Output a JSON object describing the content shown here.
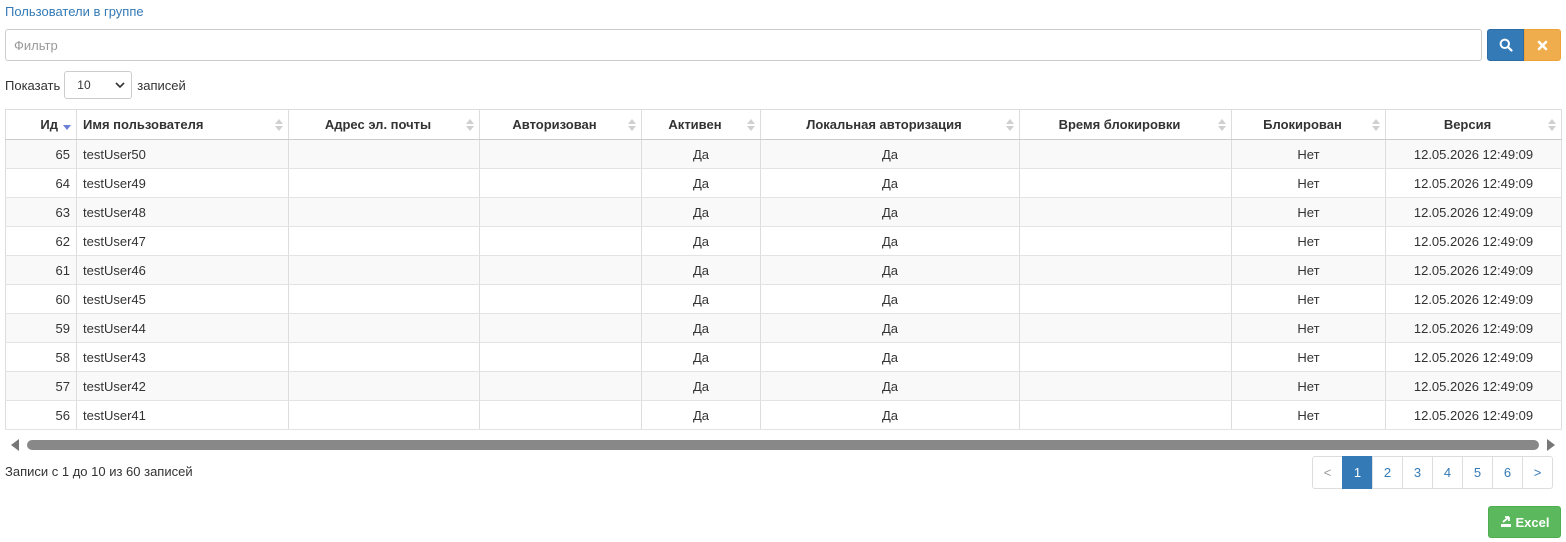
{
  "section": {
    "title": "Пользователи в группе"
  },
  "filter": {
    "placeholder": "Фильтр",
    "value": ""
  },
  "length": {
    "prefix": "Показать",
    "selected": "10",
    "suffix": "записей"
  },
  "table": {
    "columns": [
      {
        "label": "Ид",
        "sorted": "desc"
      },
      {
        "label": "Имя пользователя"
      },
      {
        "label": "Адрес эл. почты"
      },
      {
        "label": "Авторизован"
      },
      {
        "label": "Активен"
      },
      {
        "label": "Локальная авторизация"
      },
      {
        "label": "Время блокировки"
      },
      {
        "label": "Блокирован"
      },
      {
        "label": "Версия"
      }
    ],
    "rows": [
      [
        "65",
        "testUser50",
        "",
        "",
        "Да",
        "Да",
        "",
        "Нет",
        "12.05.2026 12:49:09"
      ],
      [
        "64",
        "testUser49",
        "",
        "",
        "Да",
        "Да",
        "",
        "Нет",
        "12.05.2026 12:49:09"
      ],
      [
        "63",
        "testUser48",
        "",
        "",
        "Да",
        "Да",
        "",
        "Нет",
        "12.05.2026 12:49:09"
      ],
      [
        "62",
        "testUser47",
        "",
        "",
        "Да",
        "Да",
        "",
        "Нет",
        "12.05.2026 12:49:09"
      ],
      [
        "61",
        "testUser46",
        "",
        "",
        "Да",
        "Да",
        "",
        "Нет",
        "12.05.2026 12:49:09"
      ],
      [
        "60",
        "testUser45",
        "",
        "",
        "Да",
        "Да",
        "",
        "Нет",
        "12.05.2026 12:49:09"
      ],
      [
        "59",
        "testUser44",
        "",
        "",
        "Да",
        "Да",
        "",
        "Нет",
        "12.05.2026 12:49:09"
      ],
      [
        "58",
        "testUser43",
        "",
        "",
        "Да",
        "Да",
        "",
        "Нет",
        "12.05.2026 12:49:09"
      ],
      [
        "57",
        "testUser42",
        "",
        "",
        "Да",
        "Да",
        "",
        "Нет",
        "12.05.2026 12:49:09"
      ],
      [
        "56",
        "testUser41",
        "",
        "",
        "Да",
        "Да",
        "",
        "Нет",
        "12.05.2026 12:49:09"
      ]
    ]
  },
  "info": "Записи с 1 до 10 из 60 записей",
  "pagination": {
    "prev": "<",
    "pages": [
      "1",
      "2",
      "3",
      "4",
      "5",
      "6"
    ],
    "active": "1",
    "next": ">"
  },
  "export": {
    "excel_label": "Excel"
  },
  "colors": {
    "primary": "#337ab7",
    "warning": "#f0ad4e",
    "success": "#5cb85c"
  }
}
